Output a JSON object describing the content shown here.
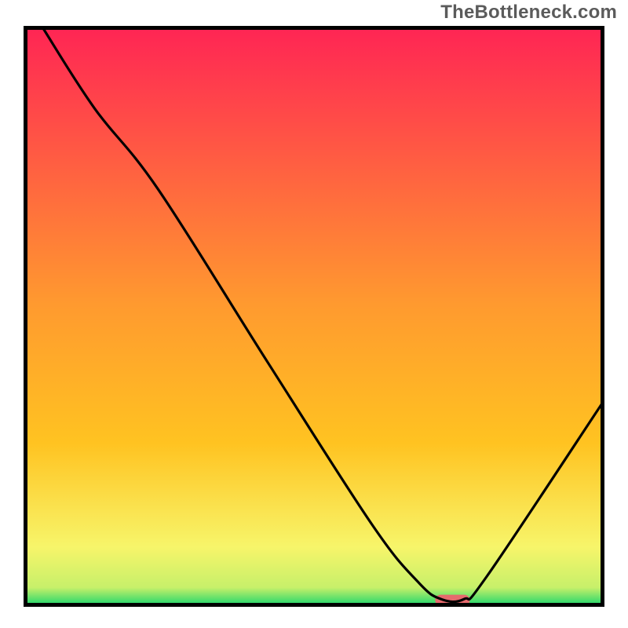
{
  "watermark": "TheBottleneck.com",
  "chart_data": {
    "type": "line",
    "title": "",
    "xlabel": "",
    "ylabel": "",
    "xlim": [
      0,
      100
    ],
    "ylim": [
      0,
      100
    ],
    "grid": false,
    "legend": false,
    "background_gradient": {
      "top_color": "#ff2554",
      "mid_color": "#ffc321",
      "lower_color": "#f7f56a",
      "bottom_color": "#22d76c"
    },
    "series": [
      {
        "name": "bottleneck-curve",
        "x": [
          3,
          12,
          23,
          42,
          60,
          68,
          72,
          76,
          80,
          100
        ],
        "y": [
          100,
          86,
          72,
          42,
          14,
          4,
          1,
          1,
          5,
          35
        ]
      }
    ],
    "marker": {
      "name": "optimal-range",
      "x_start": 71,
      "x_end": 77,
      "y": 0.8,
      "color": "#e66a6d"
    },
    "frame_color": "#000000",
    "frame_stroke_width": 5
  }
}
